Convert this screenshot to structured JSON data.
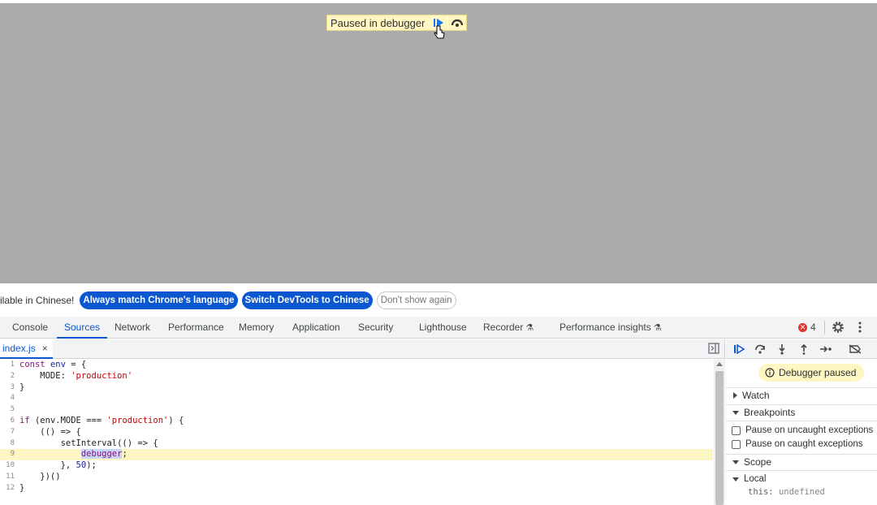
{
  "page": {
    "paused_overlay": {
      "label": "Paused in debugger",
      "resume_icon": "resume-icon",
      "step_over_icon": "step-over-icon"
    }
  },
  "infobar": {
    "message": "ilable in Chinese!",
    "match_language": "Always match Chrome's language",
    "switch_chinese": "Switch DevTools to Chinese",
    "dont_show": "Don't show again"
  },
  "devtools": {
    "tabs": [
      {
        "label": "Console"
      },
      {
        "label": "Sources"
      },
      {
        "label": "Network"
      },
      {
        "label": "Performance"
      },
      {
        "label": "Memory"
      },
      {
        "label": "Application"
      },
      {
        "label": "Security"
      },
      {
        "label": "Lighthouse"
      },
      {
        "label": "Recorder"
      },
      {
        "label": "Performance insights"
      }
    ],
    "active_tab": "Sources",
    "error_count": "4"
  },
  "editor": {
    "file_name": "index.js",
    "close_glyph": "×",
    "lines": [
      {
        "n": "1",
        "text": "const env = {"
      },
      {
        "n": "2",
        "text": "    MODE: 'production'"
      },
      {
        "n": "3",
        "text": "}"
      },
      {
        "n": "4",
        "text": ""
      },
      {
        "n": "5",
        "text": ""
      },
      {
        "n": "6",
        "text": "if (env.MODE === 'production') {"
      },
      {
        "n": "7",
        "text": "    (() => {"
      },
      {
        "n": "8",
        "text": "        setInterval(() => {"
      },
      {
        "n": "9",
        "text": "            debugger;"
      },
      {
        "n": "10",
        "text": "        }, 50);"
      },
      {
        "n": "11",
        "text": "    })()"
      },
      {
        "n": "12",
        "text": "}"
      }
    ],
    "highlighted_line": "9"
  },
  "sidebar": {
    "status": "Debugger paused",
    "watch": "Watch",
    "breakpoints": "Breakpoints",
    "pause_uncaught": "Pause on uncaught exceptions",
    "pause_caught": "Pause on caught exceptions",
    "scope": "Scope",
    "local": "Local",
    "this_key": "this:",
    "this_value": "undefined"
  },
  "colors": {
    "accent": "#0b57d0",
    "viewport_gray": "#ababab",
    "paused_yellow": "#fff6c2",
    "line_highlight": "#fdf6c3",
    "error_red": "#dc362e"
  }
}
